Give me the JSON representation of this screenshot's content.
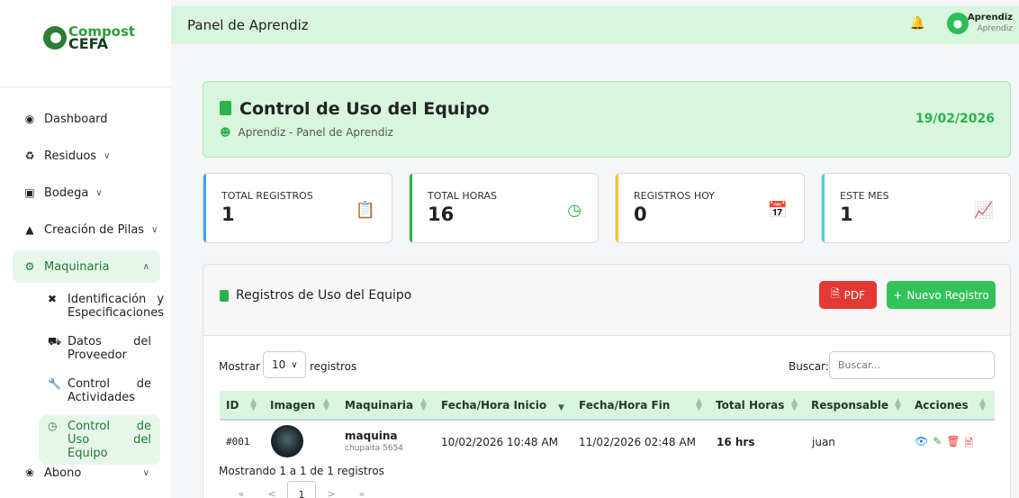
{
  "brand": {
    "line1": "Compost",
    "line2": "CEFA"
  },
  "sidebar": {
    "items": [
      {
        "label": "Dashboard",
        "icon": "globe-icon"
      },
      {
        "label": "Residuos",
        "icon": "recycle-icon"
      },
      {
        "label": "Bodega",
        "icon": "warehouse-icon"
      },
      {
        "label": "Creación de Pilas",
        "icon": "triangle-icon"
      },
      {
        "label": "Maquinaria",
        "icon": "cogs-icon"
      },
      {
        "label": "Abono",
        "icon": "seedling-icon"
      }
    ],
    "sub_items": [
      {
        "label": "Identificación y Especificaciones",
        "icon": "tools-icon"
      },
      {
        "label": "Datos del Proveedor",
        "icon": "truck-icon"
      },
      {
        "label": "Control de Actividades",
        "icon": "wrench-icon"
      },
      {
        "label": "Control de Uso del Equipo",
        "icon": "clock-icon"
      }
    ]
  },
  "header": {
    "title": "Panel de Aprendiz",
    "user_name": "Aprendiz",
    "user_role": "Aprendiz"
  },
  "hero": {
    "title": "Control de Uso del Equipo",
    "subtitle": "Aprendiz - Panel de Aprendiz",
    "date": "19/02/2026"
  },
  "stats": [
    {
      "label": "Total Registros",
      "value": "1",
      "color": "#42a5f5",
      "icon": "clipboard-icon"
    },
    {
      "label": "Total Horas",
      "value": "16",
      "color": "#2bb24c",
      "icon": "clock-icon"
    },
    {
      "label": "Registros Hoy",
      "value": "0",
      "color": "#f4c430",
      "icon": "calendar-icon"
    },
    {
      "label": "Este Mes",
      "value": "1",
      "color": "#4dd0e1",
      "icon": "chart-line-icon"
    }
  ],
  "table_panel": {
    "title": "Registros de Uso del Equipo",
    "pdf_label": "PDF",
    "new_label": "Nuevo Registro",
    "show_label": "Mostrar",
    "page_size": "10",
    "show_suffix": "registros",
    "search_label": "Buscar:",
    "search_placeholder": "Buscar...",
    "columns": [
      "ID",
      "Imagen",
      "Maquinaria",
      "Fecha/Hora Inicio",
      "Fecha/Hora Fin",
      "Total Horas",
      "Responsable",
      "Acciones"
    ],
    "rows": [
      {
        "id": "#001",
        "machine": "maquina",
        "machine_sub": "chupaita 5654",
        "start": "10/02/2026 10:48 AM",
        "end": "11/02/2026 02:48 AM",
        "hours": "16 hrs",
        "responsible": "juan"
      }
    ],
    "info": "Mostrando 1 a 1 de 1 registros",
    "pager": {
      "first": "«",
      "prev": "<",
      "page": "1",
      "next": ">",
      "last": "»"
    }
  }
}
